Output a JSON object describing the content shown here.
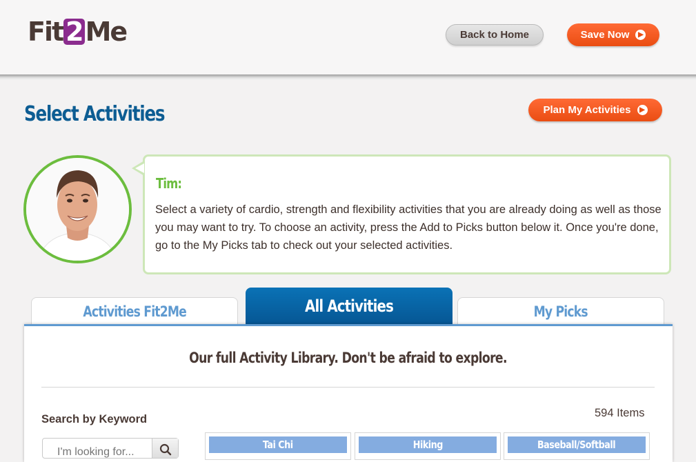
{
  "header": {
    "logo": {
      "part1": "Fit",
      "part2": "2",
      "part3": "Me"
    },
    "back_label": "Back to Home",
    "save_label": "Save Now"
  },
  "page": {
    "title": "Select Activities",
    "plan_label": "Plan My Activities"
  },
  "coach": {
    "name": "Tim:",
    "message": "Select a variety of cardio, strength and flexibility activities that you are already doing as well as those you may want to try. To choose an activity, press the Add to Picks button below it. Once you're done, go to the My Picks tab to check out your selected activities."
  },
  "tabs": [
    {
      "label": "Activities Fit2Me",
      "active": false
    },
    {
      "label": "All Activities",
      "active": true
    },
    {
      "label": "My Picks",
      "active": false
    }
  ],
  "library": {
    "title": "Our full Activity Library. Don't be afraid to explore.",
    "search_label": "Search by Keyword",
    "search_placeholder": "I'm looking for...",
    "items_count": "594 Items",
    "cards": [
      "Tai Chi",
      "Hiking",
      "Baseball/Softball"
    ]
  },
  "colors": {
    "brand_purple": "#8b2c8e",
    "title_blue": "#0d5d93",
    "orange": "#ea4d12",
    "coach_green": "#6cbd3e",
    "tab_blue": "#5f9ad0",
    "card_blue": "#84ace0"
  },
  "icons": [
    "arrow-right-circle-icon",
    "search-icon"
  ]
}
